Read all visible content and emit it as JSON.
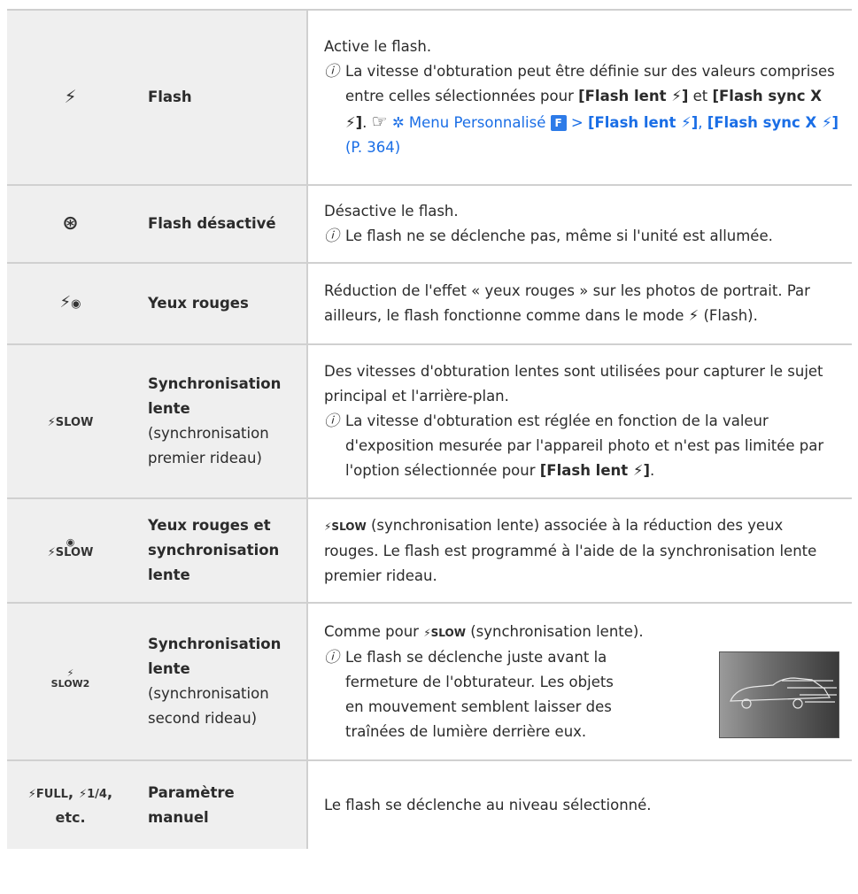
{
  "rows": [
    {
      "symbol": "⚡",
      "name": "Flash",
      "desc_line": "Active le flash.",
      "note_text_a": "La vitesse d'obturation peut être définie sur des valeurs comprises entre celles sélectionnées pour ",
      "note_bold_a": "[Flash lent ⚡]",
      "note_text_b": " et ",
      "note_bold_b": "[Flash sync X ⚡]",
      "note_text_c": ". ",
      "ref_icon": "☞",
      "gear_icon": "✲",
      "menu_link": "Menu Personnalisé",
      "menu_box": "F",
      "gt": ">",
      "link_bold_a": "[Flash lent ⚡]",
      "link_comma": ",",
      "link_bold_b": "[Flash sync X ⚡]",
      "link_page": "(P. 364)"
    },
    {
      "symbol": "⊛",
      "name": "Flash désactivé",
      "desc_line": "Désactive le flash.",
      "note_text": "Le flash ne se déclenche pas, même si l'unité est allumée."
    },
    {
      "symbol_bolt": "⚡",
      "symbol_eye": "◉",
      "name": "Yeux rouges",
      "desc_a": "Réduction de l'effet « yeux rouges » sur les photos de portrait. Par ailleurs, le flash fonctionne comme dans le mode ",
      "desc_bolt": "⚡",
      "desc_b": " (Flash)."
    },
    {
      "symbol": "⚡SLOW",
      "name": "Synchronisation lente",
      "name_sub": "(synchronisation premier rideau)",
      "desc_line": "Des vitesses d'obturation lentes sont utilisées pour capturer le sujet principal et l'arrière-plan.",
      "note_text": "La vitesse d'obturation est réglée en fonction de la valeur d'exposition mesurée par l'appareil photo et n'est pas limitée par l'option sélectionnée pour ",
      "note_bold": "[Flash lent ⚡]",
      "note_end": "."
    },
    {
      "symbol_top": "◉",
      "symbol_bottom": "⚡SLOW",
      "name": "Yeux rouges et synchronisation lente",
      "desc_sym": "⚡SLOW",
      "desc_text": " (synchronisation lente) associée à la réduction des yeux rouges. Le flash est programmé à l'aide de la synchronisation lente premier rideau."
    },
    {
      "symbol_top": "⚡",
      "symbol_bottom": "SLOW2",
      "name": "Synchronisation lente",
      "name_sub": "(synchronisation second rideau)",
      "desc_a": "Comme pour ",
      "desc_sym": "⚡SLOW",
      "desc_b": " (synchronisation lente).",
      "note_text": "Le flash se déclenche juste avant la fermeture de l'obturateur. Les objets en mouvement semblent laisser des traînées de lumière derrière eux."
    },
    {
      "symbol_a": "⚡FULL",
      "symbol_sep": ",",
      "symbol_b": "⚡1/4",
      "symbol_c": ",",
      "symbol_d": "etc.",
      "name": "Paramètre manuel",
      "desc_line": "Le flash se déclenche au niveau sélectionné."
    }
  ],
  "note_icon": "ⓘ",
  "colors": {
    "row_bg": "#efefef",
    "border": "#d0d0d0",
    "link": "#1a6ee6"
  }
}
